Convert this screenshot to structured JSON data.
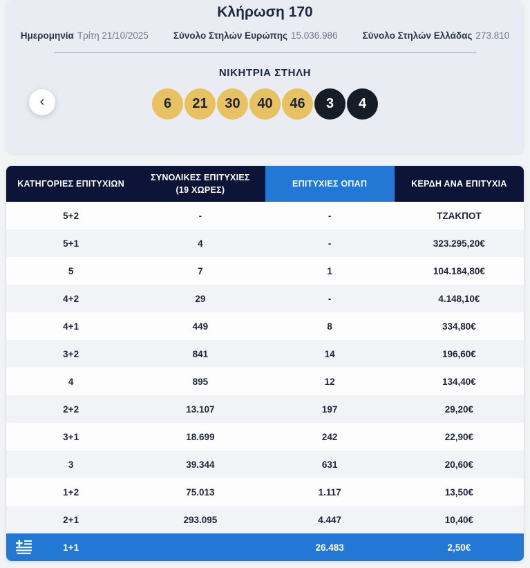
{
  "draw": {
    "title": "Κλήρωση 170",
    "date_label": "Ημερομηνία",
    "date_value": "Τρίτη 21/10/2025",
    "europe_label": "Σύνολο Στηλών Ευρώπης",
    "europe_value": "15.036.986",
    "greece_label": "Σύνολο Στηλών Ελλάδας",
    "greece_value": "273.810"
  },
  "winning": {
    "title": "ΝΙΚΗΤΡΙΑ ΣΤΗΛΗ",
    "numbers": [
      "6",
      "21",
      "30",
      "40",
      "46"
    ],
    "extra_numbers": [
      "3",
      "4"
    ],
    "prev_button_glyph": "‹"
  },
  "table": {
    "headers": [
      {
        "label": "ΚΑΤΗΓΟΡΙΕΣ ΕΠΙΤΥΧΙΩΝ"
      },
      {
        "label": "ΣΥΝΟΛΙΚΕΣ ΕΠΙΤΥΧΙΕΣ",
        "sublabel": "(19 ΧΩΡΕΣ)"
      },
      {
        "label": "ΕΠΙΤΥΧΙΕΣ ΟΠΑΠ",
        "highlight": true
      },
      {
        "label": "ΚΕΡΔΗ ΑΝΑ ΕΠΙΤΥΧΙΑ"
      }
    ],
    "rows": [
      {
        "category": "5+2",
        "total": "-",
        "opap": "-",
        "prize": "ΤΖΑΚΠΟΤ"
      },
      {
        "category": "5+1",
        "total": "4",
        "opap": "-",
        "prize": "323.295,20€"
      },
      {
        "category": "5",
        "total": "7",
        "opap": "1",
        "prize": "104.184,80€"
      },
      {
        "category": "4+2",
        "total": "29",
        "opap": "-",
        "prize": "4.148,10€"
      },
      {
        "category": "4+1",
        "total": "449",
        "opap": "8",
        "prize": "334,80€"
      },
      {
        "category": "3+2",
        "total": "841",
        "opap": "14",
        "prize": "196,60€"
      },
      {
        "category": "4",
        "total": "895",
        "opap": "12",
        "prize": "134,40€"
      },
      {
        "category": "2+2",
        "total": "13.107",
        "opap": "197",
        "prize": "29,20€"
      },
      {
        "category": "3+1",
        "total": "18.699",
        "opap": "242",
        "prize": "22,90€"
      },
      {
        "category": "3",
        "total": "39.344",
        "opap": "631",
        "prize": "20,60€"
      },
      {
        "category": "1+2",
        "total": "75.013",
        "opap": "1.117",
        "prize": "13,50€"
      },
      {
        "category": "2+1",
        "total": "293.095",
        "opap": "4.447",
        "prize": "10,40€"
      },
      {
        "category": "1+1",
        "total": "",
        "opap": "26.483",
        "prize": "2,50€",
        "highlight": true,
        "icon": "greek-flag-icon"
      }
    ]
  },
  "colors": {
    "accent_blue": "#2278d4",
    "header_navy": "#0c1537",
    "ball_gold": "#e8c262",
    "ball_dark": "#171d27",
    "card_bg": "#e9ecf3",
    "text_navy": "#1c2740"
  }
}
